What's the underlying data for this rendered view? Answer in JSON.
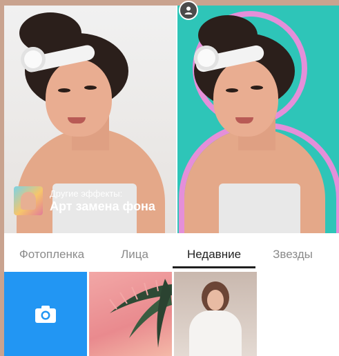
{
  "left_preview": {
    "overlay": {
      "subtitle": "Другие эффекты:",
      "title": "Арт замена фона"
    }
  },
  "right_preview": {
    "badge_icon": "user-icon",
    "background_color": "#2ec5b8",
    "outline_color": "#e48fd9"
  },
  "tabs": [
    {
      "label": "Фотопленка",
      "active": false
    },
    {
      "label": "Лица",
      "active": false
    },
    {
      "label": "Недавние",
      "active": true
    },
    {
      "label": "Звезды",
      "active": false
    }
  ],
  "gallery": {
    "camera_tile": {
      "icon": "camera-icon",
      "color": "#2296f3"
    },
    "photos": [
      "palm-leaves-photo",
      "person-photo"
    ]
  }
}
